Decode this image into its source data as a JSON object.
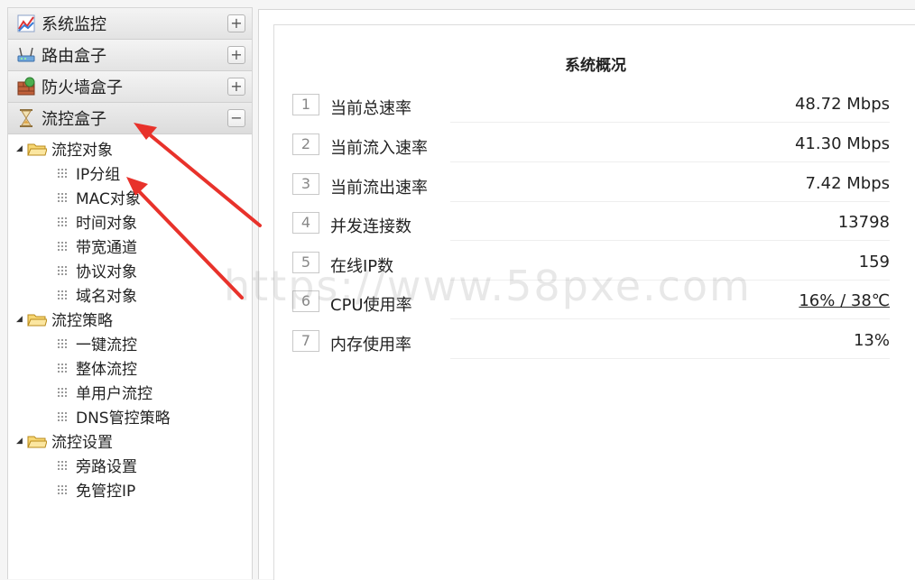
{
  "sidebar": {
    "sections": [
      {
        "label": "系统监控",
        "icon": "chart-monitor-icon",
        "toggle": "+"
      },
      {
        "label": "路由盒子",
        "icon": "router-icon",
        "toggle": "+"
      },
      {
        "label": "防火墙盒子",
        "icon": "firewall-icon",
        "toggle": "+"
      },
      {
        "label": "流控盒子",
        "icon": "hourglass-icon",
        "toggle": "−"
      }
    ],
    "tree": {
      "folders": [
        {
          "label": "流控对象",
          "items": [
            "IP分组",
            "MAC对象",
            "时间对象",
            "带宽通道",
            "协议对象",
            "域名对象"
          ]
        },
        {
          "label": "流控策略",
          "items": [
            "一键流控",
            "整体流控",
            "单用户流控",
            "DNS管控策略"
          ]
        },
        {
          "label": "流控设置",
          "items": [
            "旁路设置",
            "免管控IP"
          ]
        }
      ]
    }
  },
  "panel": {
    "title": "系统概况",
    "rows": [
      {
        "num": "1",
        "label": "当前总速率",
        "value": "48.72 Mbps"
      },
      {
        "num": "2",
        "label": "当前流入速率",
        "value": "41.30 Mbps"
      },
      {
        "num": "3",
        "label": "当前流出速率",
        "value": "7.42 Mbps"
      },
      {
        "num": "4",
        "label": "并发连接数",
        "value": "13798"
      },
      {
        "num": "5",
        "label": "在线IP数",
        "value": "159"
      },
      {
        "num": "6",
        "label": "CPU使用率",
        "value": "16% / 38℃"
      },
      {
        "num": "7",
        "label": "内存使用率",
        "value": "13%"
      }
    ]
  },
  "watermark": "https://www.58pxe.com",
  "colors": {
    "annotation_arrow": "#e8322b",
    "folder": "#f2c94c"
  }
}
